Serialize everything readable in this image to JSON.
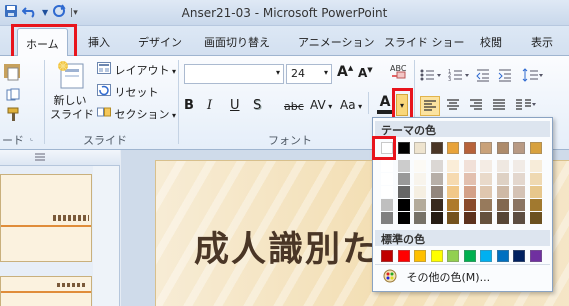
{
  "window": {
    "title": "Anser21-03  -  Microsoft PowerPoint"
  },
  "tabs": [
    {
      "label": "ホーム",
      "active": true
    },
    {
      "label": "挿入"
    },
    {
      "label": "デザイン"
    },
    {
      "label": "画面切り替え"
    },
    {
      "label": "アニメーション"
    },
    {
      "label": "スライド ショー"
    },
    {
      "label": "校閲"
    },
    {
      "label": "表示"
    }
  ],
  "ribbon": {
    "slide_group": {
      "new_slide_label_1": "新しい",
      "new_slide_label_2": "スライド",
      "layout": "レイアウト",
      "reset": "リセット",
      "section": "セクション",
      "group_label": "スライド"
    },
    "clipboard_group_label_partial": "ード",
    "font_group": {
      "font_name": "",
      "font_size": "24",
      "grow": "A",
      "shrink": "A",
      "bold": "B",
      "italic": "I",
      "underline": "U",
      "strike": "S",
      "strike_text": "abc",
      "spacing": "AV",
      "case": "Aa",
      "font_color": "A",
      "group_label": "フォント"
    }
  },
  "color_menu": {
    "theme_header": "テーマの色",
    "standard_header": "標準の色",
    "more_colors": "その他の色(M)...",
    "theme_colors": [
      "#ffffff",
      "#000000",
      "#eee4cf",
      "#4a3626",
      "#e8a33a",
      "#b7623a",
      "#c9a27a",
      "#ad8b6b",
      "#b89a84",
      "#d7a13f"
    ],
    "standard_colors": [
      "#c00000",
      "#ff0000",
      "#ffc000",
      "#ffff00",
      "#92d050",
      "#00b050",
      "#00b0f0",
      "#0070c0",
      "#002060",
      "#7030a0"
    ]
  },
  "slide": {
    "title": "成人識別た"
  }
}
